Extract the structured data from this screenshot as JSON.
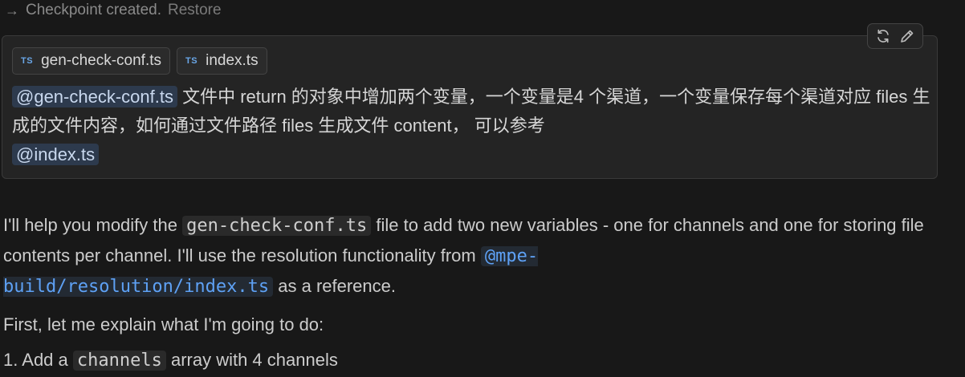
{
  "checkpoint": {
    "arrow": "→",
    "text": "Checkpoint created.",
    "restore_label": "Restore"
  },
  "user_message": {
    "actions": {
      "regenerate_icon": "refresh-icon",
      "edit_icon": "pencil-icon"
    },
    "attachments": [
      {
        "badge": "TS",
        "name": "gen-check-conf.ts"
      },
      {
        "badge": "TS",
        "name": "index.ts"
      }
    ],
    "prompt": {
      "mention1": "@gen-check-conf.ts",
      "text1": " 文件中 return 的对象中增加两个变量，一个变量是4 个渠道，一个变量保存每个渠道对应 files 生成的文件内容，如何通过文件路径 files 生成文件 content， 可以参考",
      "mention2": "@index.ts"
    }
  },
  "assistant_reply": {
    "para1": {
      "t1": "I'll help you modify the ",
      "code1": "gen-check-conf.ts",
      "t2": " file to add two new variables - one for channels and one for storing file contents per channel. I'll use the resolution functionality from ",
      "link1_line1": "@mpe-",
      "link1_line2": "build/resolution/index.ts",
      "t3": " as a reference."
    },
    "para2": "First, let me explain what I'm going to do:",
    "list": [
      {
        "num": "1.",
        "t1": "Add a ",
        "code": "channels",
        "t2": " array with 4 channels"
      }
    ]
  },
  "colors": {
    "background": "#181818",
    "card": "#242424",
    "mention_bg": "#2d3a4d",
    "link": "#5ea1f5",
    "ts_badge": "#6aa7e8"
  }
}
